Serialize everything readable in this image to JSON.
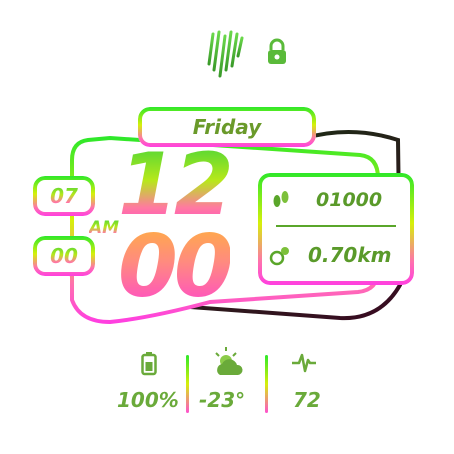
{
  "top": {
    "logo_icon": "brand-stripes-icon",
    "lock_icon": "lock-icon"
  },
  "day": {
    "label": "Friday"
  },
  "time": {
    "hour": "12",
    "minute": "00",
    "ampm": "AM"
  },
  "date": {
    "month": "07",
    "day": "00"
  },
  "activity": {
    "steps": "01000",
    "steps_icon": "footsteps-icon",
    "distance": "0.70km",
    "distance_icon": "location-icon"
  },
  "bottom": {
    "battery": {
      "value": "100%",
      "icon": "battery-icon"
    },
    "weather": {
      "value": "-23°",
      "icon": "partly-cloudy-icon"
    },
    "heart": {
      "value": "72",
      "icon": "heartbeat-icon"
    }
  },
  "colors": {
    "green": "#2ee82a",
    "lime": "#d6f00a",
    "pink": "#ff4fd0",
    "dark": "#3a1a2a"
  }
}
